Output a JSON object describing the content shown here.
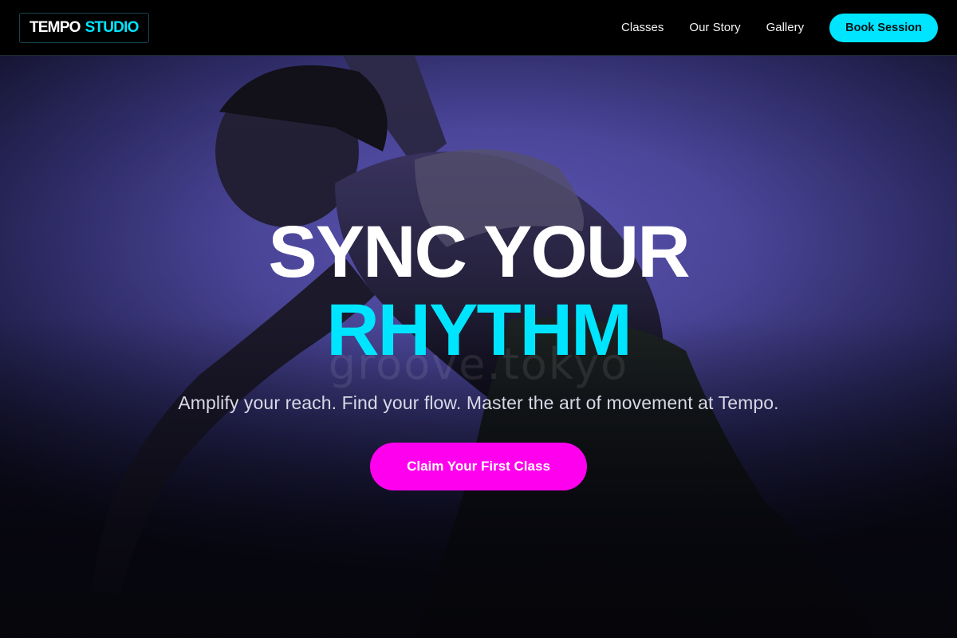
{
  "nav": {
    "logo_primary": "TEMPO",
    "logo_accent": "STUDIO",
    "links": [
      "Classes",
      "Our Story",
      "Gallery"
    ],
    "cta_label": "Book Session"
  },
  "hero": {
    "headline_line1": "SYNC YOUR",
    "headline_line2": "RHYTHM",
    "watermark": "groove.tokyo",
    "tagline": "Amplify your reach. Find your flow. Master the art of movement at Tempo.",
    "cta_label": "Claim Your First Class",
    "image": "dancer-silhouette-photo"
  },
  "colors": {
    "accent_cyan": "#00e5ff",
    "accent_magenta": "#ff00ee",
    "backdrop_purple": "#5e58b8"
  }
}
